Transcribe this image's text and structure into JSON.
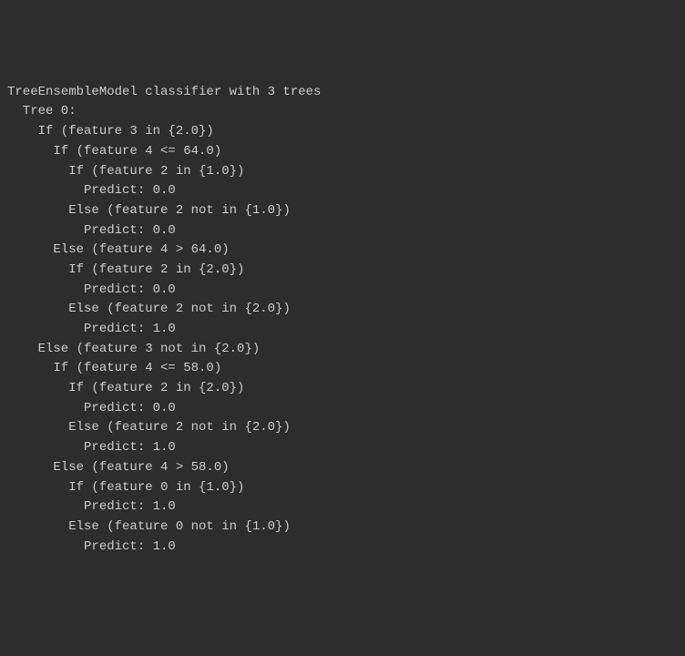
{
  "console": {
    "lines": [
      {
        "indent": 0,
        "text": "TreeEnsembleModel classifier with 3 trees"
      },
      {
        "indent": 0,
        "text": ""
      },
      {
        "indent": 1,
        "text": "Tree 0:"
      },
      {
        "indent": 2,
        "text": "If (feature 3 in {2.0})"
      },
      {
        "indent": 3,
        "text": "If (feature 4 <= 64.0)"
      },
      {
        "indent": 4,
        "text": "If (feature 2 in {1.0})"
      },
      {
        "indent": 5,
        "text": "Predict: 0.0"
      },
      {
        "indent": 4,
        "text": "Else (feature 2 not in {1.0})"
      },
      {
        "indent": 5,
        "text": "Predict: 0.0"
      },
      {
        "indent": 3,
        "text": "Else (feature 4 > 64.0)"
      },
      {
        "indent": 4,
        "text": "If (feature 2 in {2.0})"
      },
      {
        "indent": 5,
        "text": "Predict: 0.0"
      },
      {
        "indent": 4,
        "text": "Else (feature 2 not in {2.0})"
      },
      {
        "indent": 5,
        "text": "Predict: 1.0"
      },
      {
        "indent": 2,
        "text": "Else (feature 3 not in {2.0})"
      },
      {
        "indent": 3,
        "text": "If (feature 4 <= 58.0)"
      },
      {
        "indent": 4,
        "text": "If (feature 2 in {2.0})"
      },
      {
        "indent": 5,
        "text": "Predict: 0.0"
      },
      {
        "indent": 4,
        "text": "Else (feature 2 not in {2.0})"
      },
      {
        "indent": 5,
        "text": "Predict: 1.0"
      },
      {
        "indent": 3,
        "text": "Else (feature 4 > 58.0)"
      },
      {
        "indent": 4,
        "text": "If (feature 0 in {1.0})"
      },
      {
        "indent": 5,
        "text": "Predict: 1.0"
      },
      {
        "indent": 4,
        "text": "Else (feature 0 not in {1.0})"
      },
      {
        "indent": 5,
        "text": "Predict: 1.0"
      }
    ]
  }
}
